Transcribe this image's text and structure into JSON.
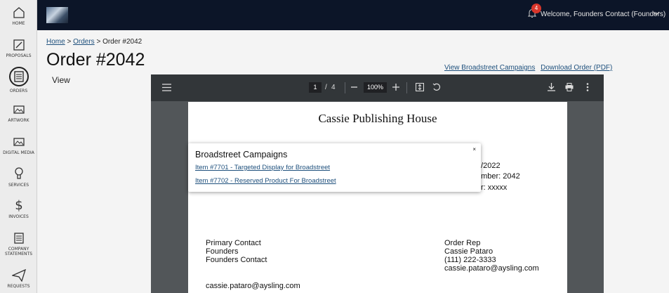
{
  "sidebar": {
    "items": [
      {
        "label": "HOME",
        "icon": "home-icon"
      },
      {
        "label": "PROPOSALS",
        "icon": "proposals-icon"
      },
      {
        "label": "ORDERS",
        "icon": "orders-icon",
        "active": true
      },
      {
        "label": "ARTWORK",
        "icon": "artwork-icon"
      },
      {
        "label": "DIGITAL MEDIA",
        "icon": "digital-media-icon"
      },
      {
        "label": "SERVICES",
        "icon": "services-icon"
      },
      {
        "label": "INVOICES",
        "icon": "invoices-icon"
      },
      {
        "label": "COMPANY",
        "label2": "STATEMENTS",
        "icon": "statements-icon"
      },
      {
        "label": "REQUESTS",
        "icon": "requests-icon"
      }
    ]
  },
  "topbar": {
    "notification_count": "4",
    "welcome_text": "Welcome, Founders Contact (Founders)"
  },
  "breadcrumb": {
    "home": "Home",
    "sep1": ">",
    "orders": "Orders",
    "sep2": ">",
    "current": "Order #2042"
  },
  "page": {
    "title": "Order #2042",
    "view_label": "View",
    "link_campaigns": "View Broadstreet Campaigns",
    "link_download": "Download Order (PDF)"
  },
  "pdf_viewer": {
    "current_page": "1",
    "page_sep": "/",
    "total_pages": "4",
    "zoom": "100%"
  },
  "pdf_page": {
    "title": "Cassie Publishing House",
    "date_fragment": "2/2022",
    "order_number_fragment": "umber: 2042",
    "po_fragment": "r: xxxxx",
    "left_block": [
      "Primary Contact",
      "Founders",
      "Founders Contact"
    ],
    "right_block": [
      "Order Rep",
      "Cassie Pataro",
      "(111) 222-3333",
      "cassie.pataro@aysling.com"
    ],
    "email": "cassie.pataro@aysling.com"
  },
  "modal": {
    "title": "Broadstreet Campaigns",
    "close": "×",
    "items": [
      "Item #7701 - Targeted Display for Broadstreet",
      "Item #7702 - Reserved Product For Broadstreet"
    ]
  },
  "colors": {
    "topbar": "#0c1528",
    "link": "#1d4f7c",
    "badge": "#d9362b",
    "pdf_toolbar": "#323639"
  }
}
